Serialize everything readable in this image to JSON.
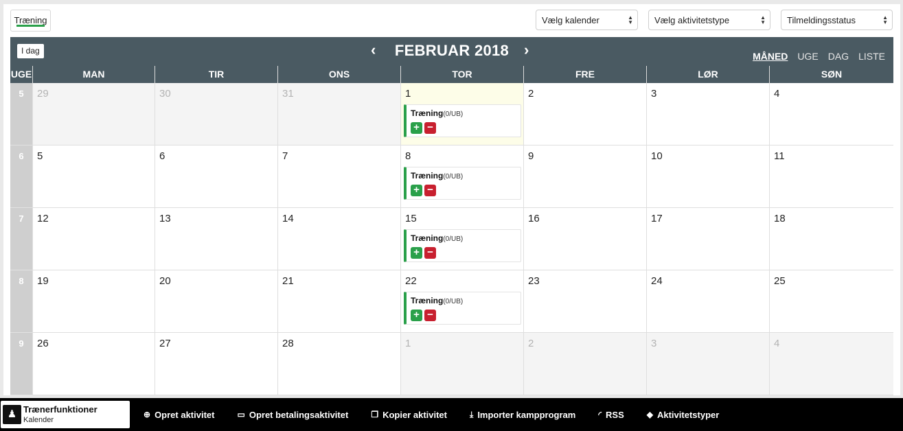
{
  "filter_chip": "Træning",
  "selects": [
    {
      "label": "Vælg kalender"
    },
    {
      "label": "Vælg aktivitetstype"
    },
    {
      "label": "Tilmeldingsstatus"
    }
  ],
  "calendar": {
    "today_label": "I dag",
    "title": "FEBRUAR 2018",
    "views": [
      "MÅNED",
      "UGE",
      "DAG",
      "LISTE"
    ],
    "active_view": "MÅNED",
    "week_col": "UGE",
    "weekdays": [
      "MAN",
      "TIR",
      "ONS",
      "TOR",
      "FRE",
      "LØR",
      "SØN"
    ],
    "weeks": [
      {
        "wk": "5",
        "days": [
          {
            "n": "29",
            "other": true
          },
          {
            "n": "30",
            "other": true
          },
          {
            "n": "31",
            "other": true
          },
          {
            "n": "1",
            "today": true,
            "event": {
              "title": "Træning",
              "sub": "(0/UB)"
            }
          },
          {
            "n": "2"
          },
          {
            "n": "3"
          },
          {
            "n": "4"
          }
        ]
      },
      {
        "wk": "6",
        "days": [
          {
            "n": "5"
          },
          {
            "n": "6"
          },
          {
            "n": "7"
          },
          {
            "n": "8",
            "event": {
              "title": "Træning",
              "sub": "(0/UB)"
            }
          },
          {
            "n": "9"
          },
          {
            "n": "10"
          },
          {
            "n": "11"
          }
        ]
      },
      {
        "wk": "7",
        "days": [
          {
            "n": "12"
          },
          {
            "n": "13"
          },
          {
            "n": "14"
          },
          {
            "n": "15",
            "event": {
              "title": "Træning",
              "sub": "(0/UB)"
            }
          },
          {
            "n": "16"
          },
          {
            "n": "17"
          },
          {
            "n": "18"
          }
        ]
      },
      {
        "wk": "8",
        "days": [
          {
            "n": "19"
          },
          {
            "n": "20"
          },
          {
            "n": "21"
          },
          {
            "n": "22",
            "event": {
              "title": "Træning",
              "sub": "(0/UB)"
            }
          },
          {
            "n": "23"
          },
          {
            "n": "24"
          },
          {
            "n": "25"
          }
        ]
      },
      {
        "wk": "9",
        "days": [
          {
            "n": "26"
          },
          {
            "n": "27"
          },
          {
            "n": "28"
          },
          {
            "n": "1",
            "other": true
          },
          {
            "n": "2",
            "other": true
          },
          {
            "n": "3",
            "other": true
          },
          {
            "n": "4",
            "other": true
          }
        ]
      }
    ]
  },
  "bottom_bar": {
    "title": "Trænerfunktioner",
    "subtitle": "Kalender",
    "actions": [
      {
        "icon": "plus-circle-icon",
        "label": "Opret aktivitet"
      },
      {
        "icon": "credit-card-icon",
        "label": "Opret betalingsaktivitet"
      },
      {
        "icon": "copy-icon",
        "label": "Kopier aktivitet"
      },
      {
        "icon": "download-icon",
        "label": "Importer kampprogram"
      },
      {
        "icon": "rss-icon",
        "label": "RSS"
      },
      {
        "icon": "tags-icon",
        "label": "Aktivitetstyper"
      }
    ]
  },
  "colors": {
    "header": "#4a5a62",
    "accent_green": "#2aa04a",
    "remove_red": "#c8202f",
    "today_bg": "#fdfde8"
  }
}
